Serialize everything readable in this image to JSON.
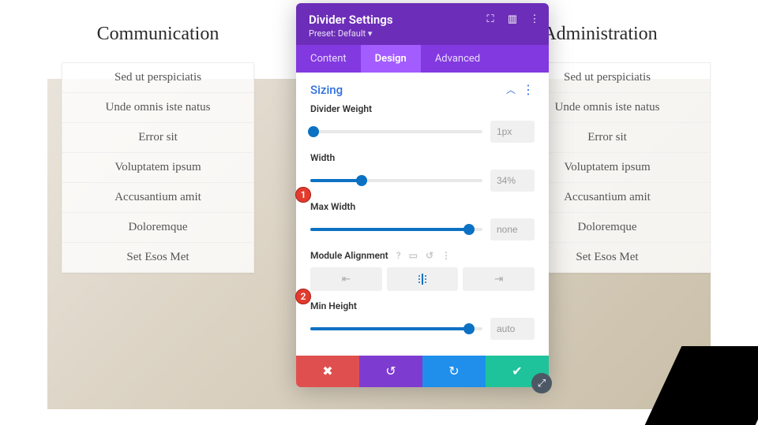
{
  "columns": {
    "left": {
      "title": "Communication",
      "items": [
        "Sed ut perspiciatis",
        "Unde omnis iste natus",
        "Error sit",
        "Voluptatem ipsum",
        "Accusantium amit",
        "Doloremque",
        "Set Esos Met"
      ]
    },
    "right": {
      "title": "Administration",
      "items": [
        "Sed ut perspiciatis",
        "Unde omnis iste natus",
        "Error sit",
        "Voluptatem ipsum",
        "Accusantium amit",
        "Doloremque",
        "Set Esos Met"
      ]
    }
  },
  "modal": {
    "title": "Divider Settings",
    "preset": "Preset: Default ▾",
    "tabs": {
      "content": "Content",
      "design": "Design",
      "advanced": "Advanced",
      "active": "design"
    },
    "section": "Sizing",
    "fields": {
      "weight": {
        "label": "Divider Weight",
        "value": "1px",
        "pos": 2
      },
      "width": {
        "label": "Width",
        "value": "34%",
        "pos": 30
      },
      "maxwidth": {
        "label": "Max Width",
        "value": "none",
        "pos": 92
      },
      "align": {
        "label": "Module Alignment",
        "active": "center"
      },
      "minheight": {
        "label": "Min Height",
        "value": "auto",
        "pos": 92
      }
    }
  },
  "badges": {
    "b1": "1",
    "b2": "2"
  }
}
